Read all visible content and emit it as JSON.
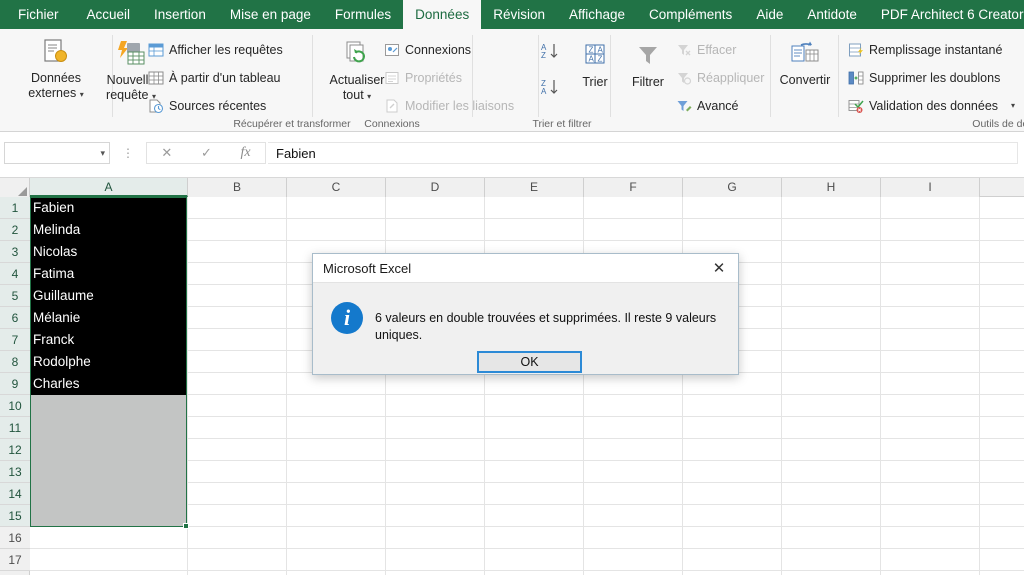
{
  "tabs": [
    {
      "label": "Fichier",
      "active": false
    },
    {
      "label": "Accueil",
      "active": false
    },
    {
      "label": "Insertion",
      "active": false
    },
    {
      "label": "Mise en page",
      "active": false
    },
    {
      "label": "Formules",
      "active": false
    },
    {
      "label": "Données",
      "active": true
    },
    {
      "label": "Révision",
      "active": false
    },
    {
      "label": "Affichage",
      "active": false
    },
    {
      "label": "Compléments",
      "active": false
    },
    {
      "label": "Aide",
      "active": false
    },
    {
      "label": "Antidote",
      "active": false
    },
    {
      "label": "PDF Architect 6 Creator",
      "active": false
    }
  ],
  "ribbon": {
    "groups": [
      {
        "title": "",
        "id": "external-data"
      },
      {
        "title": "Récupérer et transformer",
        "id": "get-transform"
      },
      {
        "title": "Connexions",
        "id": "connections"
      },
      {
        "title": "Trier et filtrer",
        "id": "sort-filter"
      },
      {
        "title": "Outils de donn",
        "id": "data-tools"
      }
    ],
    "external_data": {
      "label_line1": "Données",
      "label_line2": "externes",
      "caret": "▾"
    },
    "new_query": {
      "label_line1": "Nouvelle",
      "label_line2": "requête",
      "caret": "▾"
    },
    "show_queries": "Afficher les requêtes",
    "from_table": "À partir d'un tableau",
    "recent_sources": "Sources récentes",
    "refresh_all": {
      "label_line1": "Actualiser",
      "label_line2": "tout",
      "caret": "▾"
    },
    "connections": "Connexions",
    "properties": "Propriétés",
    "edit_links": "Modifier les liaisons",
    "sort_az": "A→Z",
    "sort_za": "Z→A",
    "sort": "Trier",
    "filter": "Filtrer",
    "clear": "Effacer",
    "reapply": "Réappliquer",
    "advanced": "Avancé",
    "convert": "Convertir",
    "flash_fill": "Remplissage instantané",
    "remove_duplicates": "Supprimer les doublons",
    "data_validation": "Validation des données",
    "data_validation_caret": "▾"
  },
  "formula_bar": {
    "name_box_value": "",
    "name_box_caret": "▾",
    "cancel_icon": "✕",
    "confirm_icon": "✓",
    "function_icon": "fx",
    "value": "Fabien"
  },
  "grid": {
    "columns": [
      "A",
      "B",
      "C",
      "D",
      "E",
      "F",
      "G",
      "H",
      "I"
    ],
    "selected_column": "A",
    "rows": [
      "1",
      "2",
      "3",
      "4",
      "5",
      "6",
      "7",
      "8",
      "9",
      "10",
      "11",
      "12",
      "13",
      "14",
      "15",
      "16",
      "17"
    ],
    "selected_rows": [
      "1",
      "2",
      "3",
      "4",
      "5",
      "6",
      "7",
      "8",
      "9",
      "10",
      "11",
      "12",
      "13",
      "14",
      "15"
    ],
    "column_a_values": [
      "Fabien",
      "Melinda",
      "Nicolas",
      "Fatima",
      "Guillaume",
      "Mélanie",
      "Franck",
      "Rodolphe",
      "Charles",
      "",
      "",
      "",
      "",
      "",
      "",
      "",
      ""
    ]
  },
  "dialog": {
    "title": "Microsoft Excel",
    "close_icon": "✕",
    "info_icon": "i",
    "message": "6 valeurs en double trouvées et supprimées. Il reste 9 valeurs uniques.",
    "ok_label": "OK"
  },
  "colors": {
    "ribbon_green": "#217346",
    "selection_green": "#217346",
    "dialog_accent": "#2c8ad6",
    "info_blue": "#1479cc"
  }
}
